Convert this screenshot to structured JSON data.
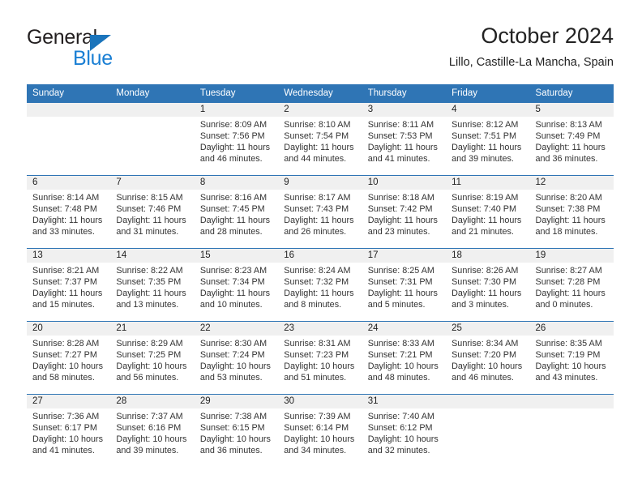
{
  "brand": {
    "name_part1": "General",
    "name_part2": "Blue",
    "triangle_color": "#1a74bb",
    "blue_text_color": "#1a7fd4"
  },
  "header": {
    "title": "October 2024",
    "subtitle": "Lillo, Castille-La Mancha, Spain"
  },
  "theme": {
    "header_blue": "#2f75b5",
    "date_band_gray": "#f0f0f0",
    "text": "#333333"
  },
  "weekdays": [
    "Sunday",
    "Monday",
    "Tuesday",
    "Wednesday",
    "Thursday",
    "Friday",
    "Saturday"
  ],
  "weeks": [
    {
      "days": [
        {
          "num": "",
          "sunrise": "",
          "sunset": "",
          "daylight": ""
        },
        {
          "num": "",
          "sunrise": "",
          "sunset": "",
          "daylight": ""
        },
        {
          "num": "1",
          "sunrise": "Sunrise: 8:09 AM",
          "sunset": "Sunset: 7:56 PM",
          "daylight": "Daylight: 11 hours and 46 minutes."
        },
        {
          "num": "2",
          "sunrise": "Sunrise: 8:10 AM",
          "sunset": "Sunset: 7:54 PM",
          "daylight": "Daylight: 11 hours and 44 minutes."
        },
        {
          "num": "3",
          "sunrise": "Sunrise: 8:11 AM",
          "sunset": "Sunset: 7:53 PM",
          "daylight": "Daylight: 11 hours and 41 minutes."
        },
        {
          "num": "4",
          "sunrise": "Sunrise: 8:12 AM",
          "sunset": "Sunset: 7:51 PM",
          "daylight": "Daylight: 11 hours and 39 minutes."
        },
        {
          "num": "5",
          "sunrise": "Sunrise: 8:13 AM",
          "sunset": "Sunset: 7:49 PM",
          "daylight": "Daylight: 11 hours and 36 minutes."
        }
      ]
    },
    {
      "days": [
        {
          "num": "6",
          "sunrise": "Sunrise: 8:14 AM",
          "sunset": "Sunset: 7:48 PM",
          "daylight": "Daylight: 11 hours and 33 minutes."
        },
        {
          "num": "7",
          "sunrise": "Sunrise: 8:15 AM",
          "sunset": "Sunset: 7:46 PM",
          "daylight": "Daylight: 11 hours and 31 minutes."
        },
        {
          "num": "8",
          "sunrise": "Sunrise: 8:16 AM",
          "sunset": "Sunset: 7:45 PM",
          "daylight": "Daylight: 11 hours and 28 minutes."
        },
        {
          "num": "9",
          "sunrise": "Sunrise: 8:17 AM",
          "sunset": "Sunset: 7:43 PM",
          "daylight": "Daylight: 11 hours and 26 minutes."
        },
        {
          "num": "10",
          "sunrise": "Sunrise: 8:18 AM",
          "sunset": "Sunset: 7:42 PM",
          "daylight": "Daylight: 11 hours and 23 minutes."
        },
        {
          "num": "11",
          "sunrise": "Sunrise: 8:19 AM",
          "sunset": "Sunset: 7:40 PM",
          "daylight": "Daylight: 11 hours and 21 minutes."
        },
        {
          "num": "12",
          "sunrise": "Sunrise: 8:20 AM",
          "sunset": "Sunset: 7:38 PM",
          "daylight": "Daylight: 11 hours and 18 minutes."
        }
      ]
    },
    {
      "days": [
        {
          "num": "13",
          "sunrise": "Sunrise: 8:21 AM",
          "sunset": "Sunset: 7:37 PM",
          "daylight": "Daylight: 11 hours and 15 minutes."
        },
        {
          "num": "14",
          "sunrise": "Sunrise: 8:22 AM",
          "sunset": "Sunset: 7:35 PM",
          "daylight": "Daylight: 11 hours and 13 minutes."
        },
        {
          "num": "15",
          "sunrise": "Sunrise: 8:23 AM",
          "sunset": "Sunset: 7:34 PM",
          "daylight": "Daylight: 11 hours and 10 minutes."
        },
        {
          "num": "16",
          "sunrise": "Sunrise: 8:24 AM",
          "sunset": "Sunset: 7:32 PM",
          "daylight": "Daylight: 11 hours and 8 minutes."
        },
        {
          "num": "17",
          "sunrise": "Sunrise: 8:25 AM",
          "sunset": "Sunset: 7:31 PM",
          "daylight": "Daylight: 11 hours and 5 minutes."
        },
        {
          "num": "18",
          "sunrise": "Sunrise: 8:26 AM",
          "sunset": "Sunset: 7:30 PM",
          "daylight": "Daylight: 11 hours and 3 minutes."
        },
        {
          "num": "19",
          "sunrise": "Sunrise: 8:27 AM",
          "sunset": "Sunset: 7:28 PM",
          "daylight": "Daylight: 11 hours and 0 minutes."
        }
      ]
    },
    {
      "days": [
        {
          "num": "20",
          "sunrise": "Sunrise: 8:28 AM",
          "sunset": "Sunset: 7:27 PM",
          "daylight": "Daylight: 10 hours and 58 minutes."
        },
        {
          "num": "21",
          "sunrise": "Sunrise: 8:29 AM",
          "sunset": "Sunset: 7:25 PM",
          "daylight": "Daylight: 10 hours and 56 minutes."
        },
        {
          "num": "22",
          "sunrise": "Sunrise: 8:30 AM",
          "sunset": "Sunset: 7:24 PM",
          "daylight": "Daylight: 10 hours and 53 minutes."
        },
        {
          "num": "23",
          "sunrise": "Sunrise: 8:31 AM",
          "sunset": "Sunset: 7:23 PM",
          "daylight": "Daylight: 10 hours and 51 minutes."
        },
        {
          "num": "24",
          "sunrise": "Sunrise: 8:33 AM",
          "sunset": "Sunset: 7:21 PM",
          "daylight": "Daylight: 10 hours and 48 minutes."
        },
        {
          "num": "25",
          "sunrise": "Sunrise: 8:34 AM",
          "sunset": "Sunset: 7:20 PM",
          "daylight": "Daylight: 10 hours and 46 minutes."
        },
        {
          "num": "26",
          "sunrise": "Sunrise: 8:35 AM",
          "sunset": "Sunset: 7:19 PM",
          "daylight": "Daylight: 10 hours and 43 minutes."
        }
      ]
    },
    {
      "days": [
        {
          "num": "27",
          "sunrise": "Sunrise: 7:36 AM",
          "sunset": "Sunset: 6:17 PM",
          "daylight": "Daylight: 10 hours and 41 minutes."
        },
        {
          "num": "28",
          "sunrise": "Sunrise: 7:37 AM",
          "sunset": "Sunset: 6:16 PM",
          "daylight": "Daylight: 10 hours and 39 minutes."
        },
        {
          "num": "29",
          "sunrise": "Sunrise: 7:38 AM",
          "sunset": "Sunset: 6:15 PM",
          "daylight": "Daylight: 10 hours and 36 minutes."
        },
        {
          "num": "30",
          "sunrise": "Sunrise: 7:39 AM",
          "sunset": "Sunset: 6:14 PM",
          "daylight": "Daylight: 10 hours and 34 minutes."
        },
        {
          "num": "31",
          "sunrise": "Sunrise: 7:40 AM",
          "sunset": "Sunset: 6:12 PM",
          "daylight": "Daylight: 10 hours and 32 minutes."
        },
        {
          "num": "",
          "sunrise": "",
          "sunset": "",
          "daylight": ""
        },
        {
          "num": "",
          "sunrise": "",
          "sunset": "",
          "daylight": ""
        }
      ]
    }
  ]
}
